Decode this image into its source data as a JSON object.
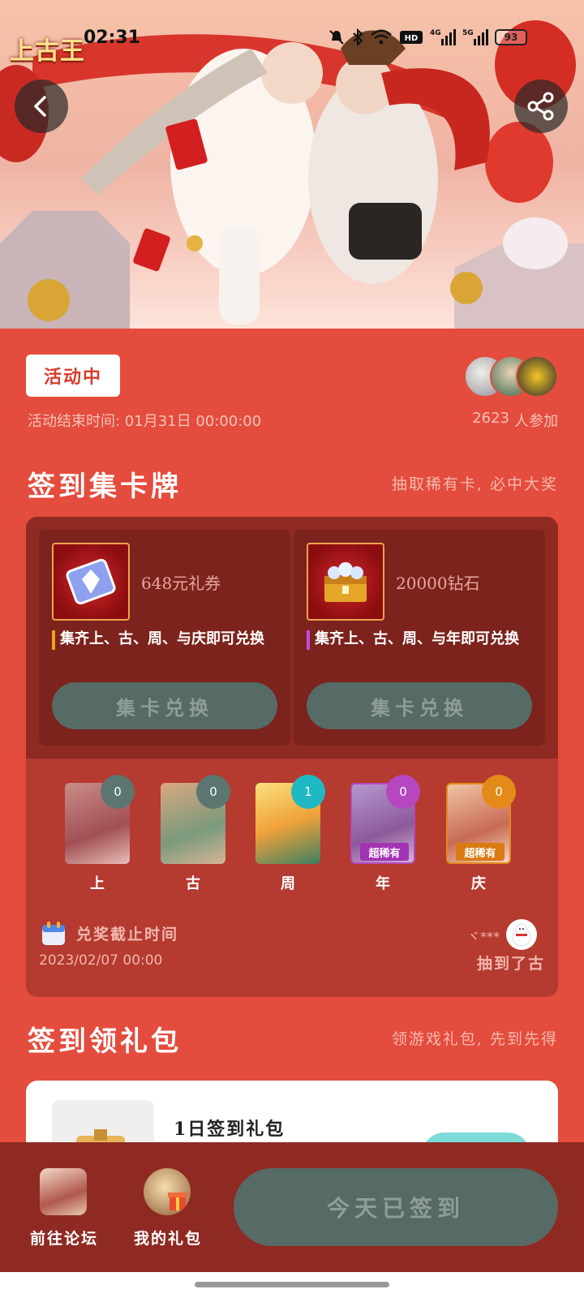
{
  "status_bar": {
    "time": "02:31",
    "battery": "93",
    "network_labels": [
      "HD",
      "4G",
      "5G"
    ]
  },
  "hero": {
    "game_logo": "上古王"
  },
  "activity": {
    "status": "活动中",
    "end_time": "活动结束时间: 01月31日  00:00:00",
    "participants_count": "2623",
    "participants_suffix": "人参加"
  },
  "collect_section": {
    "title": "签到集卡牌",
    "subtitle": "抽取稀有卡, 必中大奖",
    "rewards": [
      {
        "name": "648元礼券",
        "desc": "集齐上、古、周、与庆即可兑换",
        "button": "集卡兑换",
        "accent": "#f0a21c"
      },
      {
        "name": "20000钻石",
        "desc": "集齐上、古、周、与年即可兑换",
        "button": "集卡兑换",
        "accent": "#c64bdc"
      }
    ],
    "cards": [
      {
        "label": "上",
        "count": "0",
        "badge_color": "#5c7570",
        "tag": ""
      },
      {
        "label": "古",
        "count": "0",
        "badge_color": "#5c7570",
        "tag": ""
      },
      {
        "label": "周",
        "count": "1",
        "badge_color": "#1fb9c4",
        "tag": ""
      },
      {
        "label": "年",
        "count": "0",
        "badge_color": "#b548c0",
        "tag": "超稀有"
      },
      {
        "label": "庆",
        "count": "0",
        "badge_color": "#e38a18",
        "tag": "超稀有"
      }
    ],
    "deadline_label": "兑奖截止时间",
    "deadline_date": "2023/02/07  00:00",
    "winner_name": "ヾ***",
    "winner_text": "抽到了古"
  },
  "gift_section": {
    "title": "签到领礼包",
    "subtitle": "领游戏礼包, 先到先得",
    "first_gift_title": "1日签到礼包"
  },
  "bottom_bar": {
    "forum_label": "前往论坛",
    "my_gifts_label": "我的礼包",
    "signed_button": "今天已签到"
  }
}
